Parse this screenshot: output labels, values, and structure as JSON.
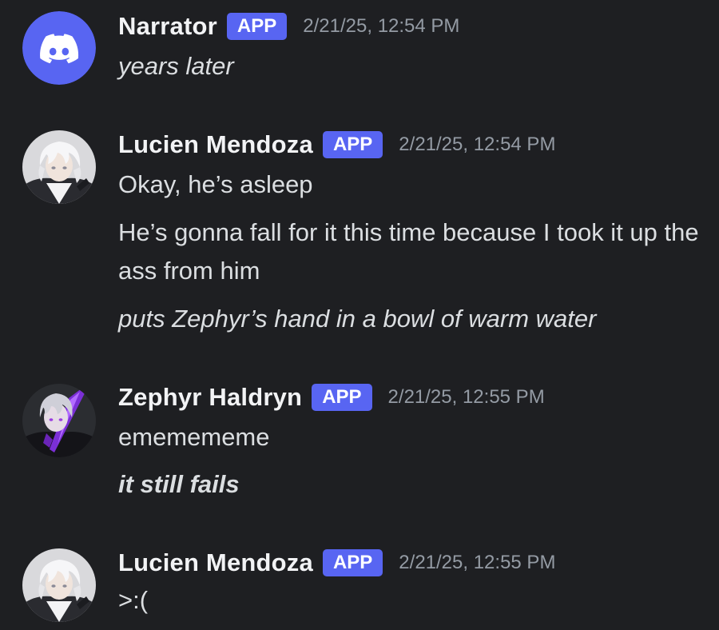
{
  "messages": [
    {
      "author": "Narrator",
      "badge": "APP",
      "timestamp": "2/21/25, 12:54 PM",
      "avatar": "discord-logo-icon",
      "lines": [
        "years later"
      ]
    },
    {
      "author": "Lucien Mendoza",
      "badge": "APP",
      "timestamp": "2/21/25, 12:54 PM",
      "avatar": "white-haired-character-avatar",
      "lines": [
        "Okay, he’s asleep",
        "He’s gonna fall for it this time because I took it up the ass from him",
        "puts Zephyr’s hand in a bowl of warm water"
      ]
    },
    {
      "author": "Zephyr Haldryn",
      "badge": "APP",
      "timestamp": "2/21/25, 12:55 PM",
      "avatar": "purple-sword-character-avatar",
      "lines": [
        "ememememe",
        "it still fails"
      ]
    },
    {
      "author": "Lucien Mendoza",
      "badge": "APP",
      "timestamp": "2/21/25, 12:55 PM",
      "avatar": "white-haired-character-avatar",
      "lines": [
        ">:("
      ]
    }
  ],
  "colors": {
    "background": "#1e1f22",
    "badge": "#5865f2",
    "text": "#dbdee1",
    "username": "#f2f3f5",
    "timestamp": "#949ba4"
  }
}
